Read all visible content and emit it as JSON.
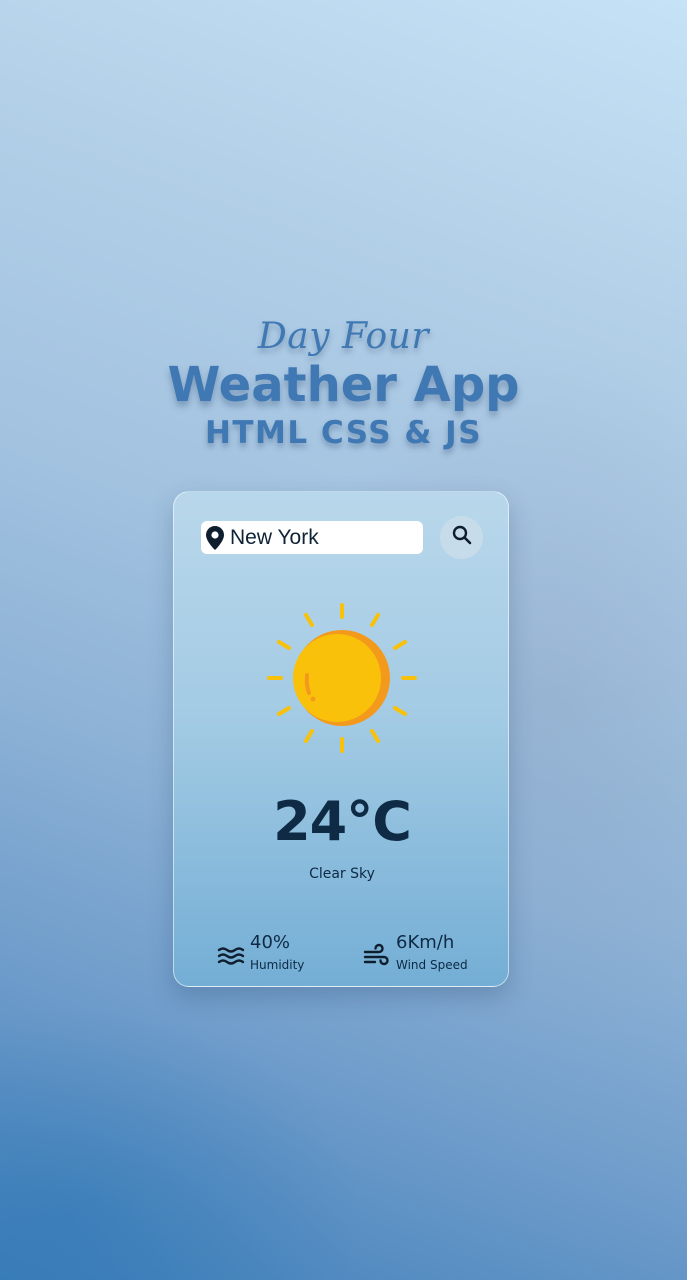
{
  "header": {
    "day_label": "Day Four",
    "title": "Weather App",
    "subtitle": "HTML CSS & JS"
  },
  "search": {
    "value": "New York",
    "icon_location": "location-pin-icon",
    "icon_button": "search-icon"
  },
  "weather": {
    "icon": "sun-icon",
    "temperature": "24°C",
    "description": "Clear Sky"
  },
  "stats": {
    "humidity": {
      "value": "40%",
      "label": "Humidity",
      "icon": "humidity-waves-icon"
    },
    "wind": {
      "value": "6Km/h",
      "label": "Wind Speed",
      "icon": "wind-icon"
    }
  },
  "colors": {
    "accent_text": "#3f78b3",
    "dark_text": "#0e2a44",
    "sun_yellow": "#f9c10a",
    "sun_orange": "#f39a1d"
  }
}
